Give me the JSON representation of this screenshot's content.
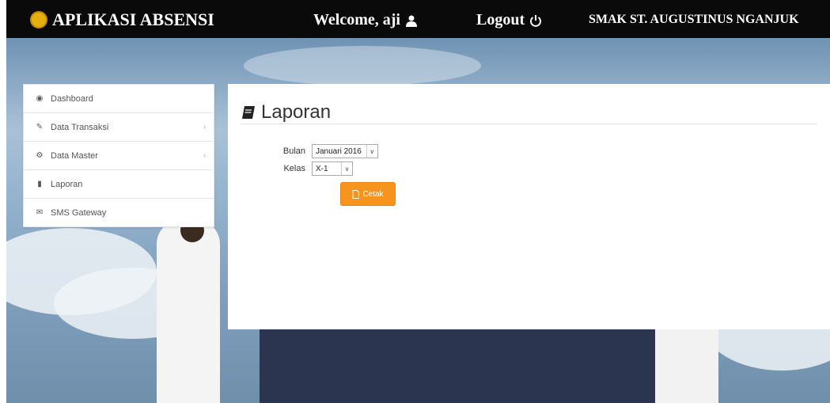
{
  "header": {
    "app_title": "APLIKASI ABSENSI",
    "welcome": "Welcome, aji",
    "logout": "Logout",
    "school": "SMAK ST. AUGUSTINUS NGANJUK"
  },
  "sidebar": {
    "items": [
      {
        "label": "Dashboard",
        "icon": "dashboard-icon"
      },
      {
        "label": "Data Transaksi",
        "icon": "edit-icon",
        "has_submenu": true
      },
      {
        "label": "Data Master",
        "icon": "gear-icon",
        "has_submenu": true
      },
      {
        "label": "Laporan",
        "icon": "book-icon"
      },
      {
        "label": "SMS Gateway",
        "icon": "envelope-icon"
      }
    ]
  },
  "main": {
    "title": "Laporan",
    "form": {
      "bulan_label": "Bulan",
      "bulan_value": "Januari 2016",
      "kelas_label": "Kelas",
      "kelas_value": "X-1",
      "submit_label": "Cetak"
    }
  },
  "colors": {
    "header_bg": "#0a0a0a",
    "brand_text": "#ffffff",
    "button_orange": "#f7941d"
  }
}
